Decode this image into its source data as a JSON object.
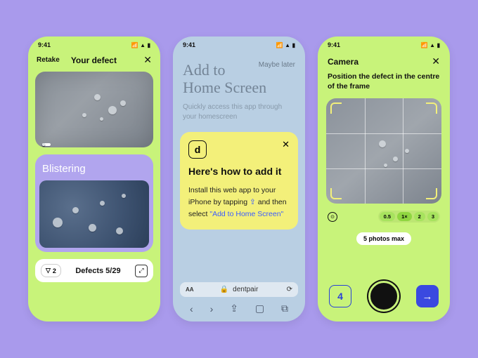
{
  "status": {
    "time": "9:41"
  },
  "phone1": {
    "retake": "Retake",
    "title": "Your defect",
    "defect_name": "Blistering",
    "filter_count": "2",
    "defects_label": "Defects 5/29"
  },
  "phone2": {
    "maybe_later": "Maybe later",
    "title_line1": "Add to",
    "title_line2": "Home Screen",
    "subtitle": "Quickly access this app through your homescreen",
    "card": {
      "icon_glyph": "d",
      "title": "Here's how to add it",
      "body_1": "Install this web app to your iPhone by tapping",
      "body_2": "and then select",
      "link": "\"Add to Home Screen\""
    },
    "url": "dentpair",
    "aa": "AA"
  },
  "phone3": {
    "title": "Camera",
    "instruction": "Position the defect in the centre of the frame",
    "zoom": {
      "options": [
        "0.5",
        "1×",
        "2",
        "3"
      ],
      "selected": 1
    },
    "max_label": "5 photos max",
    "count": "4"
  }
}
